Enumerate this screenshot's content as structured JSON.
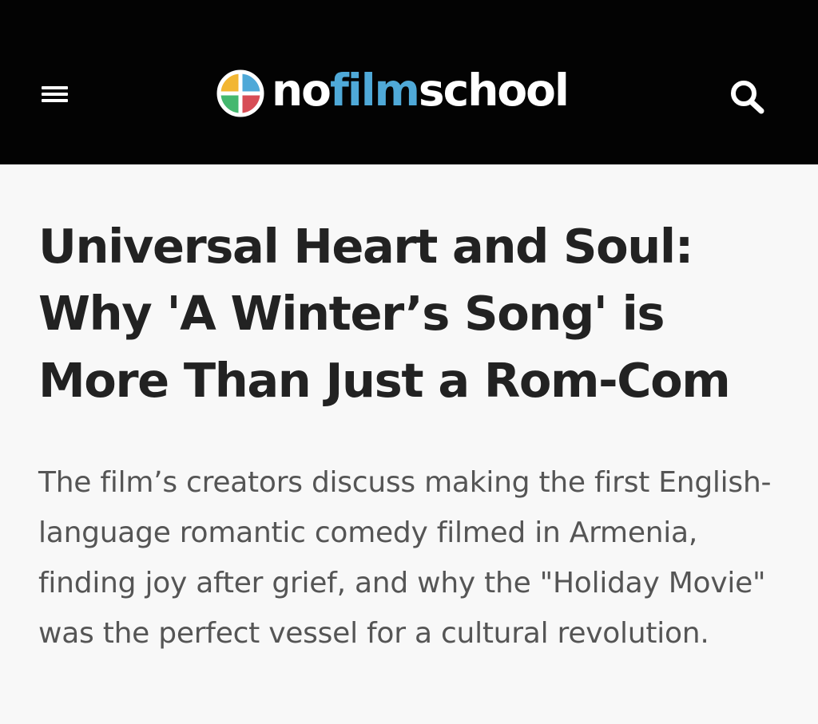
{
  "header": {
    "menu_icon": "hamburger-menu-icon",
    "search_icon": "search-icon",
    "logo": {
      "prefix": "no",
      "middle": "film",
      "suffix": "school",
      "mark_colors": [
        "#f2b632",
        "#4fa9d8",
        "#d74d56",
        "#45b86f"
      ],
      "accent_color": "#4fa9d8"
    }
  },
  "article": {
    "headline": "Universal Heart and Soul: Why 'A Winter’s Song' is More Than Just a Rom-Com",
    "subhead": "The film’s creators discuss making the first English-language romantic comedy filmed in Armenia, finding joy after grief, and why the \"Holiday Movie\" was the perfect vessel for a cultural revolution."
  }
}
